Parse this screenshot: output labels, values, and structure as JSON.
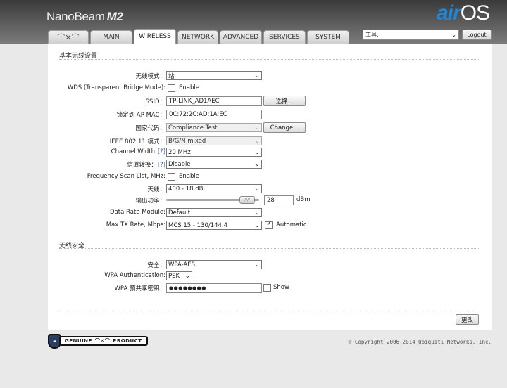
{
  "header": {
    "brand_name": "NanoBeam",
    "brand_model": "M2",
    "logo_air": "air",
    "logo_os": "OS"
  },
  "tabs": [
    {
      "label": "",
      "icon": "ubnt-logo-icon"
    },
    {
      "label": "MAIN"
    },
    {
      "label": "WIRELESS",
      "active": true
    },
    {
      "label": "NETWORK"
    },
    {
      "label": "ADVANCED"
    },
    {
      "label": "SERVICES"
    },
    {
      "label": "SYSTEM"
    }
  ],
  "toolbar": {
    "tools_value": "工具:",
    "logout_label": "Logout"
  },
  "basic": {
    "title": "基本无线设置",
    "wireless_mode": {
      "label": "无线模式：",
      "value": "站"
    },
    "wds": {
      "label": "WDS (Transparent Bridge Mode):",
      "option": "Enable",
      "checked": false
    },
    "ssid": {
      "label": "SSID：",
      "value": "TP-LINK_AD1AEC",
      "button": "选择..."
    },
    "lock_ap": {
      "label": "锁定到 AP MAC：",
      "value": "0C:72:2C:AD:1A:EC"
    },
    "country": {
      "label": "国家代码：",
      "value": "Compliance Test",
      "button": "Change..."
    },
    "ieee_mode": {
      "label": "IEEE 802.11 模式：",
      "value": "B/G/N mixed"
    },
    "channel_width": {
      "label": "Channel Width:",
      "help": "[?]",
      "value": "20 MHz"
    },
    "channel_shift": {
      "label": "信道转换：",
      "help": "[?]",
      "value": "Disable"
    },
    "freq_scan": {
      "label": "Frequency Scan List, MHz:",
      "option": "Enable",
      "checked": false
    },
    "antenna": {
      "label": "天线：",
      "value": "400 - 18 dBi"
    },
    "output_power": {
      "label": "输出功率：",
      "value": "28",
      "unit": "dBm",
      "slider_fraction": 0.95
    },
    "data_rate_module": {
      "label": "Data Rate Module:",
      "value": "Default"
    },
    "max_tx_rate": {
      "label": "Max TX Rate, Mbps:",
      "value": "MCS 15 - 130/144.4",
      "option": "Automatic",
      "checked": true
    }
  },
  "security": {
    "title": "无线安全",
    "security_mode": {
      "label": "安全：",
      "value": "WPA-AES"
    },
    "wpa_auth": {
      "label": "WPA Authentication:",
      "value": "PSK"
    },
    "wpa_key": {
      "label": "WPA 预共享密钥：",
      "value": "●●●●●●●●",
      "option": "Show",
      "checked": false
    }
  },
  "apply_label": "更改",
  "footer": {
    "genuine_left": "GENUINE",
    "genuine_right": "PRODUCT",
    "copyright": "© Copyright 2006-2014 Ubiquiti Networks, Inc."
  }
}
